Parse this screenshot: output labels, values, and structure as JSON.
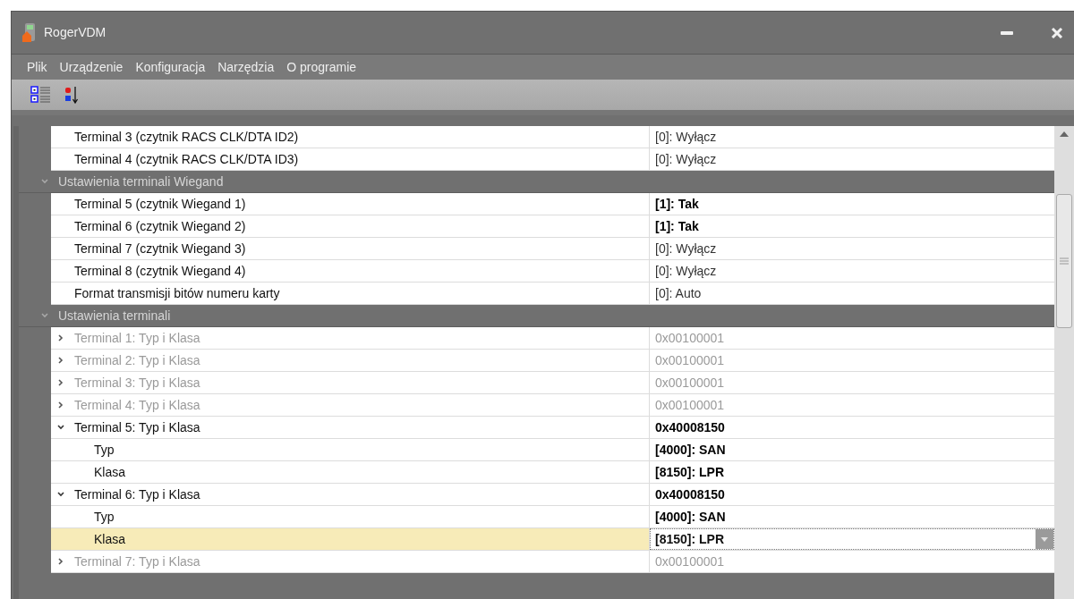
{
  "window": {
    "title": "RogerVDM"
  },
  "menu": [
    "Plik",
    "Urządzenie",
    "Konfiguracja",
    "Narzędzia",
    "O programie"
  ],
  "toolbar": [
    {
      "kind": "categorized",
      "selected": false
    },
    {
      "kind": "alphabetical",
      "selected": false
    }
  ],
  "grid": [
    {
      "kind": "property",
      "label": "Terminal 3 (czytnik RACS CLK/DTA ID2)",
      "value": "[0]: Wyłącz",
      "bold": false,
      "dimmed": false,
      "selected": false
    },
    {
      "kind": "property",
      "label": "Terminal 4 (czytnik RACS CLK/DTA ID3)",
      "value": "[0]: Wyłącz",
      "bold": false,
      "dimmed": false,
      "selected": false
    },
    {
      "kind": "category",
      "label": "Ustawienia terminali Wiegand",
      "expanded": true,
      "children": [
        {
          "kind": "property",
          "label": "Terminal 5 (czytnik Wiegand 1)",
          "value": "[1]: Tak",
          "bold": true,
          "dimmed": false,
          "selected": false
        },
        {
          "kind": "property",
          "label": "Terminal 6 (czytnik Wiegand 2)",
          "value": "[1]: Tak",
          "bold": true,
          "dimmed": false,
          "selected": false
        },
        {
          "kind": "property",
          "label": "Terminal 7 (czytnik Wiegand 3)",
          "value": "[0]: Wyłącz",
          "bold": false,
          "dimmed": false,
          "selected": false
        },
        {
          "kind": "property",
          "label": "Terminal 8 (czytnik Wiegand 4)",
          "value": "[0]: Wyłącz",
          "bold": false,
          "dimmed": false,
          "selected": false
        },
        {
          "kind": "property",
          "label": "Format transmisji bitów numeru karty",
          "value": "[0]: Auto",
          "bold": false,
          "dimmed": false,
          "selected": false
        }
      ]
    },
    {
      "kind": "category",
      "label": "Ustawienia terminali",
      "expanded": true,
      "children": [
        {
          "kind": "property",
          "label": "Terminal 1: Typ i Klasa",
          "value": "0x00100001",
          "bold": false,
          "dimmed": true,
          "selected": false,
          "expanded": false
        },
        {
          "kind": "property",
          "label": "Terminal 2: Typ i Klasa",
          "value": "0x00100001",
          "bold": false,
          "dimmed": true,
          "selected": false,
          "expanded": false
        },
        {
          "kind": "property",
          "label": "Terminal 3: Typ i Klasa",
          "value": "0x00100001",
          "bold": false,
          "dimmed": true,
          "selected": false,
          "expanded": false
        },
        {
          "kind": "property",
          "label": "Terminal 4: Typ i Klasa",
          "value": "0x00100001",
          "bold": false,
          "dimmed": true,
          "selected": false,
          "expanded": false
        },
        {
          "kind": "property",
          "label": "Terminal 5: Typ i Klasa",
          "value": "0x40008150",
          "bold": true,
          "dimmed": false,
          "selected": false,
          "expanded": true,
          "children": [
            {
              "kind": "property",
              "label": "Typ",
              "value": "[4000]: SAN",
              "bold": true,
              "dimmed": false,
              "selected": false
            },
            {
              "kind": "property",
              "label": "Klasa",
              "value": "[8150]: LPR",
              "bold": true,
              "dimmed": false,
              "selected": false
            }
          ]
        },
        {
          "kind": "property",
          "label": "Terminal 6: Typ i Klasa",
          "value": "0x40008150",
          "bold": true,
          "dimmed": false,
          "selected": false,
          "expanded": true,
          "children": [
            {
              "kind": "property",
              "label": "Typ",
              "value": "[4000]: SAN",
              "bold": true,
              "dimmed": false,
              "selected": false
            },
            {
              "kind": "property",
              "label": "Klasa",
              "value": "[8150]: LPR",
              "bold": true,
              "dimmed": false,
              "selected": true
            }
          ]
        },
        {
          "kind": "property",
          "label": "Terminal 7: Typ i Klasa",
          "value": "0x00100001",
          "bold": false,
          "dimmed": true,
          "selected": false,
          "expanded": false
        }
      ]
    }
  ]
}
